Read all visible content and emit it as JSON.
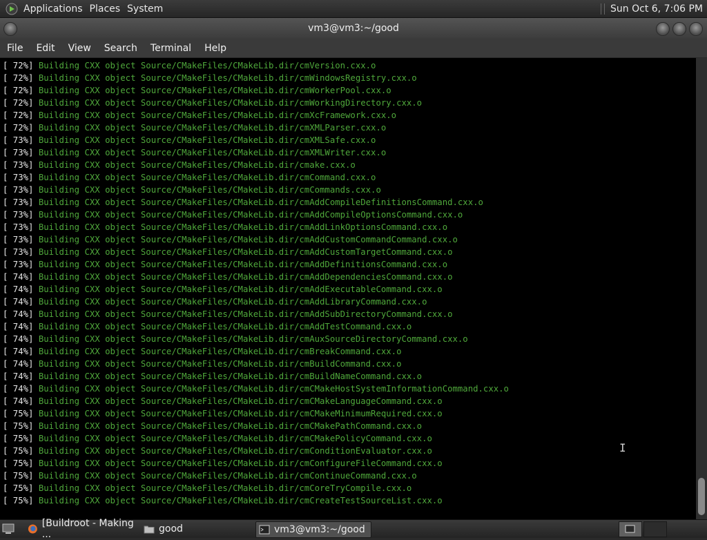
{
  "top_panel": {
    "menus": [
      "Applications",
      "Places",
      "System"
    ],
    "clock": "Sun Oct  6,  7:06 PM"
  },
  "window": {
    "title": "vm3@vm3:~/good"
  },
  "menubar": {
    "items": [
      "File",
      "Edit",
      "View",
      "Search",
      "Terminal",
      "Help"
    ]
  },
  "terminal": {
    "lines": [
      {
        "pct": "[ 72%]",
        "msg": "Building CXX object Source/CMakeFiles/CMakeLib.dir/cmVersion.cxx.o"
      },
      {
        "pct": "[ 72%]",
        "msg": "Building CXX object Source/CMakeFiles/CMakeLib.dir/cmWindowsRegistry.cxx.o"
      },
      {
        "pct": "[ 72%]",
        "msg": "Building CXX object Source/CMakeFiles/CMakeLib.dir/cmWorkerPool.cxx.o"
      },
      {
        "pct": "[ 72%]",
        "msg": "Building CXX object Source/CMakeFiles/CMakeLib.dir/cmWorkingDirectory.cxx.o"
      },
      {
        "pct": "[ 72%]",
        "msg": "Building CXX object Source/CMakeFiles/CMakeLib.dir/cmXcFramework.cxx.o"
      },
      {
        "pct": "[ 72%]",
        "msg": "Building CXX object Source/CMakeFiles/CMakeLib.dir/cmXMLParser.cxx.o"
      },
      {
        "pct": "[ 73%]",
        "msg": "Building CXX object Source/CMakeFiles/CMakeLib.dir/cmXMLSafe.cxx.o"
      },
      {
        "pct": "[ 73%]",
        "msg": "Building CXX object Source/CMakeFiles/CMakeLib.dir/cmXMLWriter.cxx.o"
      },
      {
        "pct": "[ 73%]",
        "msg": "Building CXX object Source/CMakeFiles/CMakeLib.dir/cmake.cxx.o"
      },
      {
        "pct": "[ 73%]",
        "msg": "Building CXX object Source/CMakeFiles/CMakeLib.dir/cmCommand.cxx.o"
      },
      {
        "pct": "[ 73%]",
        "msg": "Building CXX object Source/CMakeFiles/CMakeLib.dir/cmCommands.cxx.o"
      },
      {
        "pct": "[ 73%]",
        "msg": "Building CXX object Source/CMakeFiles/CMakeLib.dir/cmAddCompileDefinitionsCommand.cxx.o"
      },
      {
        "pct": "[ 73%]",
        "msg": "Building CXX object Source/CMakeFiles/CMakeLib.dir/cmAddCompileOptionsCommand.cxx.o"
      },
      {
        "pct": "[ 73%]",
        "msg": "Building CXX object Source/CMakeFiles/CMakeLib.dir/cmAddLinkOptionsCommand.cxx.o"
      },
      {
        "pct": "[ 73%]",
        "msg": "Building CXX object Source/CMakeFiles/CMakeLib.dir/cmAddCustomCommandCommand.cxx.o"
      },
      {
        "pct": "[ 73%]",
        "msg": "Building CXX object Source/CMakeFiles/CMakeLib.dir/cmAddCustomTargetCommand.cxx.o"
      },
      {
        "pct": "[ 73%]",
        "msg": "Building CXX object Source/CMakeFiles/CMakeLib.dir/cmAddDefinitionsCommand.cxx.o"
      },
      {
        "pct": "[ 74%]",
        "msg": "Building CXX object Source/CMakeFiles/CMakeLib.dir/cmAddDependenciesCommand.cxx.o"
      },
      {
        "pct": "[ 74%]",
        "msg": "Building CXX object Source/CMakeFiles/CMakeLib.dir/cmAddExecutableCommand.cxx.o"
      },
      {
        "pct": "[ 74%]",
        "msg": "Building CXX object Source/CMakeFiles/CMakeLib.dir/cmAddLibraryCommand.cxx.o"
      },
      {
        "pct": "[ 74%]",
        "msg": "Building CXX object Source/CMakeFiles/CMakeLib.dir/cmAddSubDirectoryCommand.cxx.o"
      },
      {
        "pct": "[ 74%]",
        "msg": "Building CXX object Source/CMakeFiles/CMakeLib.dir/cmAddTestCommand.cxx.o"
      },
      {
        "pct": "[ 74%]",
        "msg": "Building CXX object Source/CMakeFiles/CMakeLib.dir/cmAuxSourceDirectoryCommand.cxx.o"
      },
      {
        "pct": "[ 74%]",
        "msg": "Building CXX object Source/CMakeFiles/CMakeLib.dir/cmBreakCommand.cxx.o"
      },
      {
        "pct": "[ 74%]",
        "msg": "Building CXX object Source/CMakeFiles/CMakeLib.dir/cmBuildCommand.cxx.o"
      },
      {
        "pct": "[ 74%]",
        "msg": "Building CXX object Source/CMakeFiles/CMakeLib.dir/cmBuildNameCommand.cxx.o"
      },
      {
        "pct": "[ 74%]",
        "msg": "Building CXX object Source/CMakeFiles/CMakeLib.dir/cmCMakeHostSystemInformationCommand.cxx.o"
      },
      {
        "pct": "[ 74%]",
        "msg": "Building CXX object Source/CMakeFiles/CMakeLib.dir/cmCMakeLanguageCommand.cxx.o"
      },
      {
        "pct": "[ 75%]",
        "msg": "Building CXX object Source/CMakeFiles/CMakeLib.dir/cmCMakeMinimumRequired.cxx.o"
      },
      {
        "pct": "[ 75%]",
        "msg": "Building CXX object Source/CMakeFiles/CMakeLib.dir/cmCMakePathCommand.cxx.o"
      },
      {
        "pct": "[ 75%]",
        "msg": "Building CXX object Source/CMakeFiles/CMakeLib.dir/cmCMakePolicyCommand.cxx.o"
      },
      {
        "pct": "[ 75%]",
        "msg": "Building CXX object Source/CMakeFiles/CMakeLib.dir/cmConditionEvaluator.cxx.o"
      },
      {
        "pct": "[ 75%]",
        "msg": "Building CXX object Source/CMakeFiles/CMakeLib.dir/cmConfigureFileCommand.cxx.o"
      },
      {
        "pct": "[ 75%]",
        "msg": "Building CXX object Source/CMakeFiles/CMakeLib.dir/cmContinueCommand.cxx.o"
      },
      {
        "pct": "[ 75%]",
        "msg": "Building CXX object Source/CMakeFiles/CMakeLib.dir/cmCoreTryCompile.cxx.o"
      },
      {
        "pct": "[ 75%]",
        "msg": "Building CXX object Source/CMakeFiles/CMakeLib.dir/cmCreateTestSourceList.cxx.o"
      }
    ],
    "colors": {
      "background": "#000000",
      "percent": "#e8e8e8",
      "message": "#4fa83b"
    }
  },
  "taskbar": {
    "tasks": [
      {
        "label": "[Buildroot - Making ...",
        "icon": "firefox-icon"
      },
      {
        "label": "good",
        "icon": "folder-icon"
      },
      {
        "label": "vm3@vm3:~/good",
        "icon": "terminal-icon"
      }
    ]
  }
}
